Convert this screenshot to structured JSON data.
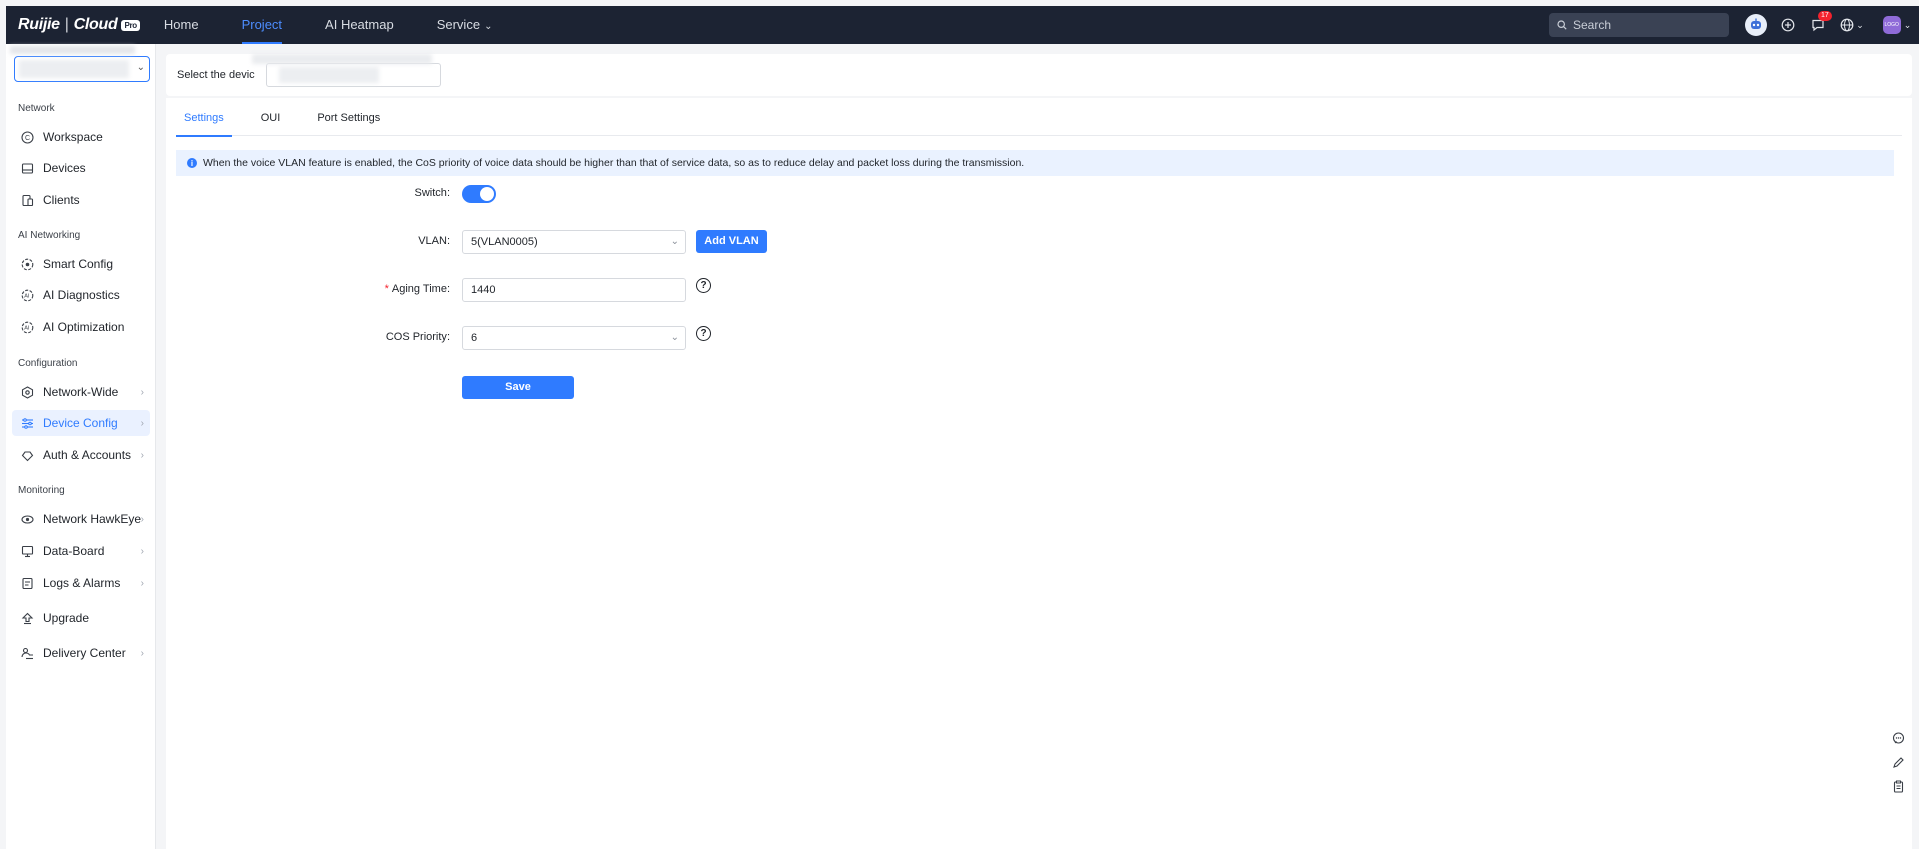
{
  "header": {
    "logo_brand": "Ruijie",
    "logo_sep": "|",
    "logo_product": "Cloud",
    "logo_pro": "Pro",
    "nav": [
      {
        "label": "Home"
      },
      {
        "label": "Project",
        "active": true
      },
      {
        "label": "AI Heatmap"
      },
      {
        "label": "Service",
        "has_dropdown": true
      }
    ],
    "search_placeholder": "Search",
    "notification_count": "17",
    "avatar_text": "LOGO"
  },
  "sidebar": {
    "sections": [
      {
        "title": "Network",
        "items": [
          {
            "label": "Workspace",
            "icon": "workspace-icon"
          },
          {
            "label": "Devices",
            "icon": "devices-icon"
          },
          {
            "label": "Clients",
            "icon": "clients-icon"
          }
        ]
      },
      {
        "title": "AI Networking",
        "items": [
          {
            "label": "Smart Config",
            "icon": "smart-config-icon"
          },
          {
            "label": "AI Diagnostics",
            "icon": "ai-diagnostics-icon"
          },
          {
            "label": "AI Optimization",
            "icon": "ai-optimization-icon"
          }
        ]
      },
      {
        "title": "Configuration",
        "items": [
          {
            "label": "Network-Wide",
            "icon": "network-wide-icon",
            "expandable": true
          },
          {
            "label": "Device Config",
            "icon": "device-config-icon",
            "expandable": true,
            "active": true
          },
          {
            "label": "Auth & Accounts",
            "icon": "auth-icon",
            "expandable": true
          }
        ]
      },
      {
        "title": "Monitoring",
        "items": [
          {
            "label": "Network HawkEye",
            "icon": "hawkeye-icon",
            "expandable": true
          },
          {
            "label": "Data-Board",
            "icon": "data-board-icon",
            "expandable": true
          },
          {
            "label": "Logs & Alarms",
            "icon": "logs-icon",
            "expandable": true
          },
          {
            "label": "Upgrade",
            "icon": "upgrade-icon"
          },
          {
            "label": "Delivery Center",
            "icon": "delivery-icon",
            "expandable": true
          }
        ]
      }
    ]
  },
  "device_bar": {
    "label": "Select the devic"
  },
  "tabs": [
    {
      "label": "Settings",
      "active": true
    },
    {
      "label": "OUI"
    },
    {
      "label": "Port Settings"
    }
  ],
  "notice": "When the voice VLAN feature is enabled, the CoS priority of voice data should be higher than that of service data, so as to reduce delay and packet loss during the transmission.",
  "form": {
    "switch_label": "Switch",
    "switch_on": true,
    "vlan_label": "VLAN",
    "vlan_value": "5(VLAN0005)",
    "add_vlan_label": "Add VLAN",
    "aging_label": "Aging Time",
    "aging_required_mark": "*",
    "aging_value": "1440",
    "cos_label": "COS Priority",
    "cos_value": "6",
    "colon": ":",
    "save_label": "Save",
    "help_glyph": "?"
  },
  "colors": {
    "accent": "#2f7bff",
    "topbar": "#1c2333",
    "notice_bg": "#eaf2ff"
  }
}
